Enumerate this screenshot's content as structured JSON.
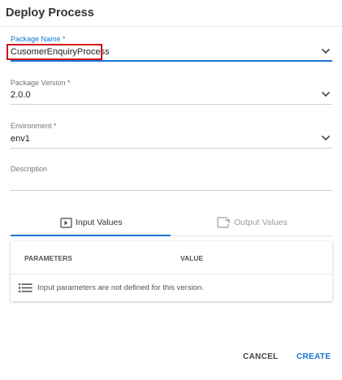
{
  "dialog": {
    "title": "Deploy Process"
  },
  "form": {
    "package_name": {
      "label": "Package Name *",
      "value": "CusomerEnquiryProcess"
    },
    "package_version": {
      "label": "Package Version *",
      "value": "2.0.0"
    },
    "environment": {
      "label": "Environment *",
      "value": "env1"
    },
    "description": {
      "label": "Description",
      "value": ""
    }
  },
  "tabs": [
    {
      "label": "Input Values",
      "icon": "input-icon",
      "active": true
    },
    {
      "label": "Output Values",
      "icon": "output-icon",
      "active": false
    }
  ],
  "parameters_table": {
    "columns": [
      "PARAMETERS",
      "VALUE"
    ],
    "empty_message": "Input parameters are not defined for this version.",
    "empty_icon": "list-icon"
  },
  "actions": {
    "cancel_label": "CANCEL",
    "create_label": "CREATE"
  },
  "colors": {
    "accent": "#1976d2",
    "highlight_border": "#d0121b"
  }
}
